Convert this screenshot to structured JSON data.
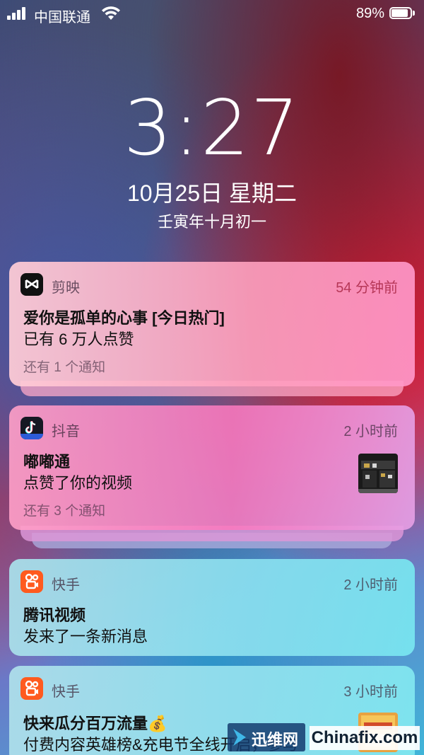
{
  "status_bar": {
    "carrier": "中国联通",
    "battery_text": "89%",
    "battery_level": 0.89
  },
  "lock_screen": {
    "time": "3:27",
    "date": "10月25日 星期二",
    "lunar_date": "壬寅年十月初一"
  },
  "notifications": [
    {
      "app": "剪映",
      "icon": "capcut-icon",
      "time": "54 分钟前",
      "title": "爱你是孤单的心事 [今日热门]",
      "body": "已有 6 万人点赞",
      "more": "还有 1 个通知"
    },
    {
      "app": "抖音",
      "icon": "douyin-icon",
      "time": "2 小时前",
      "title": "嘟嘟通",
      "body": "点赞了你的视频",
      "more": "还有 3 个通知"
    },
    {
      "app": "快手",
      "icon": "kuaishou-icon",
      "time": "2 小时前",
      "title": "腾讯视频",
      "body": "发来了一条新消息"
    },
    {
      "app": "快手",
      "icon": "kuaishou-icon",
      "time": "3 小时前",
      "title": "快来瓜分百万流量💰",
      "body": "付费内容英雄榜&充电节全线开启，参与"
    }
  ],
  "watermark": {
    "brand_cn": "迅维网",
    "brand_en": "Chinafix.com"
  }
}
